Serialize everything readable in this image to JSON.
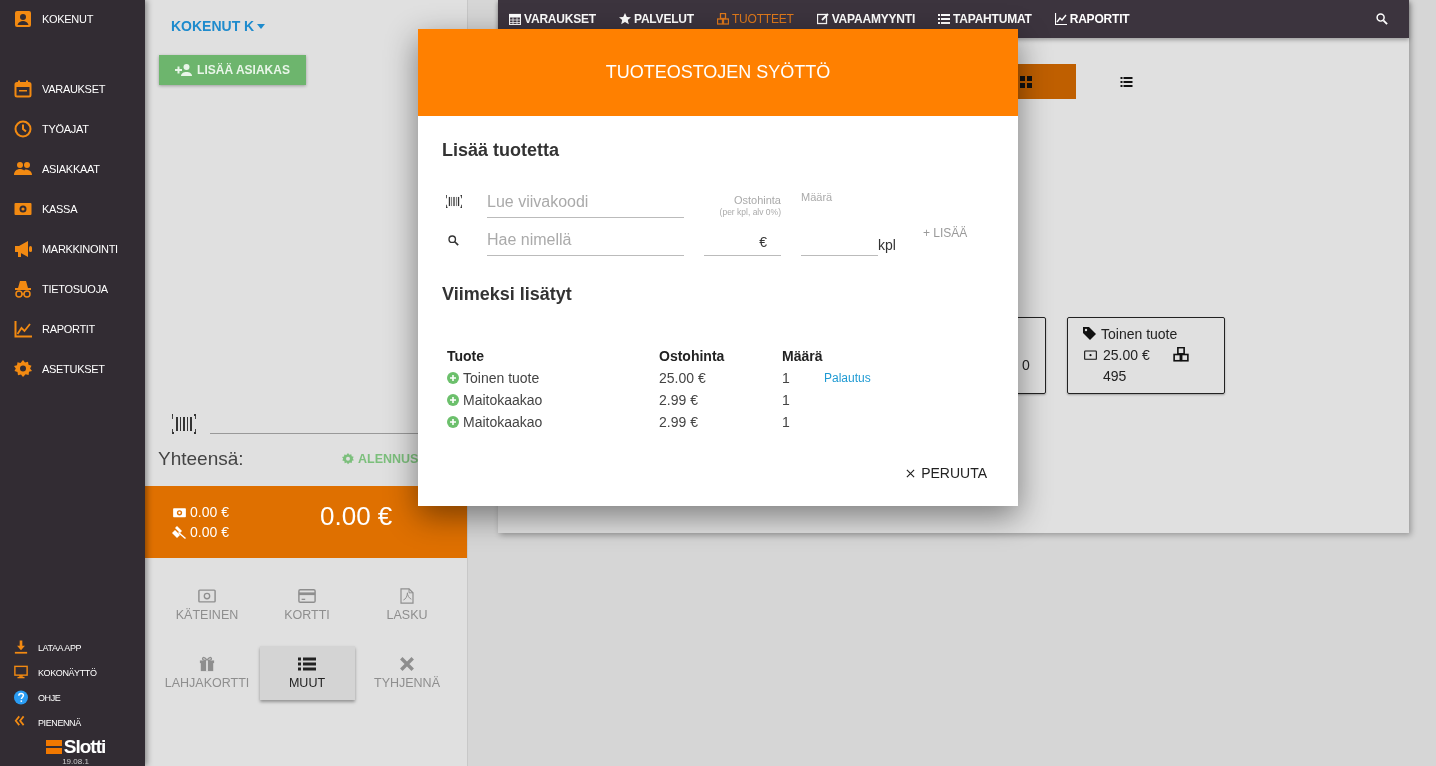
{
  "sidebar": {
    "user": "KOKENUT",
    "items": [
      {
        "label": "VARAUKSET"
      },
      {
        "label": "TYÖAJAT"
      },
      {
        "label": "ASIAKKAAT"
      },
      {
        "label": "KASSA"
      },
      {
        "label": "MARKKINOINTI"
      },
      {
        "label": "TIETOSUOJA"
      },
      {
        "label": "RAPORTIT"
      },
      {
        "label": "ASETUKSET"
      }
    ],
    "footer_items": [
      {
        "label": "LATAA APP"
      },
      {
        "label": "KOKONÄYTTÖ"
      },
      {
        "label": "OHJE"
      },
      {
        "label": "PIENENNÄ"
      }
    ],
    "logo": "Slotti",
    "version": "19.08.1"
  },
  "pos": {
    "user_menu": "KOKENUT K",
    "add_customer": "LISÄÄ ASIAKAS",
    "total_label": "Yhteensä:",
    "discount": "ALENNUS",
    "cash_total": "0.00 €",
    "tips_total": "0.00 €",
    "grand_total": "0.00 €",
    "actions": [
      {
        "label": "KÄTEINEN",
        "disabled": true
      },
      {
        "label": "KORTTI",
        "disabled": true
      },
      {
        "label": "LASKU",
        "disabled": true
      },
      {
        "label": "LAHJAKORTTI",
        "disabled": true
      },
      {
        "label": "MUUT",
        "disabled": false
      },
      {
        "label": "TYHJENNÄ",
        "disabled": true
      }
    ]
  },
  "nav": {
    "tabs": [
      {
        "label": "VARAUKSET",
        "selected": false
      },
      {
        "label": "PALVELUT",
        "selected": false
      },
      {
        "label": "TUOTTEET",
        "selected": true
      },
      {
        "label": "VAPAAMYYNTI",
        "selected": false
      },
      {
        "label": "TAPAHTUMAT",
        "selected": false
      },
      {
        "label": "RAPORTIT",
        "selected": false
      }
    ]
  },
  "view_toggle": [
    {
      "kind": "grid",
      "selected": true
    },
    {
      "kind": "list",
      "selected": false
    }
  ],
  "products": [
    {
      "stock": "0"
    },
    {
      "name": "Toinen tuote",
      "price": "25.00 €",
      "stock": "495"
    }
  ],
  "dialog": {
    "title": "TUOTEOSTOJEN SYÖTTÖ",
    "add_heading": "Lisää tuotetta",
    "barcode_field": {
      "placeholder": "Lue viivakoodi"
    },
    "name_field": {
      "placeholder": "Hae nimellä"
    },
    "price_field": {
      "label": "Ostohinta",
      "hint": "(per kpl, alv 0%)",
      "suffix": "€"
    },
    "quantity_field": {
      "label": "Määrä",
      "suffix": "kpl"
    },
    "add_button": {
      "label": "+ LISÄÄ",
      "disabled": true
    },
    "recent_heading": "Viimeksi lisätyt",
    "table": {
      "columns": [
        "Tuote",
        "Ostohinta",
        "Määrä"
      ],
      "rows": [
        {
          "product": "Toinen tuote",
          "price": "25.00 €",
          "quantity": "1",
          "action": "Palautus"
        },
        {
          "product": "Maitokaakao",
          "price": "2.99 €",
          "quantity": "1"
        },
        {
          "product": "Maitokaakao",
          "price": "2.99 €",
          "quantity": "1"
        }
      ]
    },
    "cancel_button": "PERUUTA"
  }
}
